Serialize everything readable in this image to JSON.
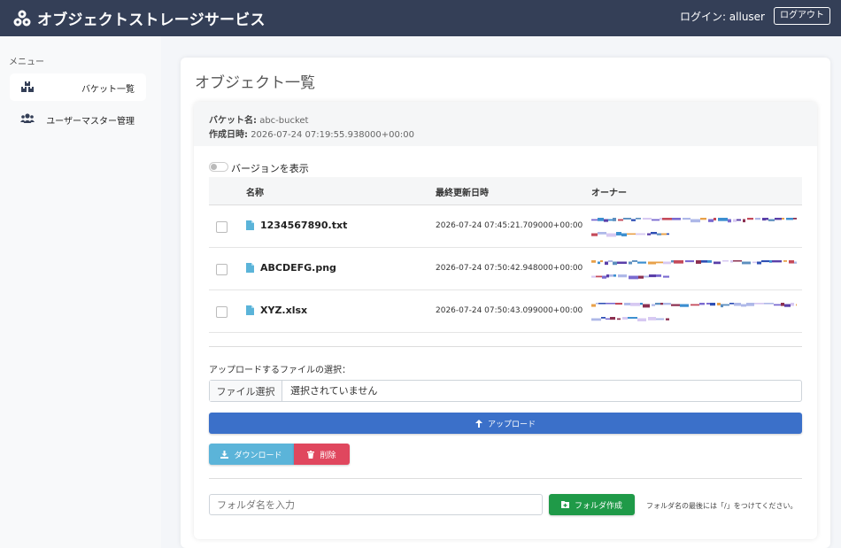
{
  "header": {
    "app_title": "オブジェクトストレージサービス",
    "login_text": "ログイン: alluser",
    "logout_label": "ログアウト",
    "background": "#343f57"
  },
  "sidebar": {
    "menu_label": "メニュー",
    "items": [
      {
        "label": "バケット一覧",
        "icon": "boxes-icon"
      },
      {
        "label": "ユーザーマスター管理",
        "icon": "users-icon"
      }
    ]
  },
  "main": {
    "page_title": "オブジェクト一覧",
    "bucket": {
      "name_label": "バケット名:",
      "name_value": "abc-bucket",
      "created_label": "作成日時:",
      "created_value": "2026-07-24 07:19:55.938000+00:00"
    },
    "version_toggle": {
      "label": "バージョンを表示",
      "checked": false
    },
    "table": {
      "columns": [
        "名称",
        "最終更新日時",
        "オーナー"
      ],
      "rows": [
        {
          "name": "1234567890.txt",
          "modified": "2026-07-24 07:45:21.709000+00:00",
          "owner_redacted": true
        },
        {
          "name": "ABCDEFG.png",
          "modified": "2026-07-24 07:50:42.948000+00:00",
          "owner_redacted": true
        },
        {
          "name": "XYZ.xlsx",
          "modified": "2026-07-24 07:50:43.099000+00:00",
          "owner_redacted": true
        }
      ]
    },
    "upload": {
      "label": "アップロードするファイルの選択：",
      "file_button": "ファイル選択",
      "file_status": "選択されていません",
      "upload_button": "アップロード",
      "upload_color": "#3b70c9"
    },
    "actions": {
      "download_label": "ダウンロード",
      "download_color": "#5bb4d9",
      "delete_label": "削除",
      "delete_color": "#e0475e"
    },
    "folder": {
      "placeholder": "フォルダ名を入力",
      "create_label": "フォルダ作成",
      "create_color": "#1f9a48",
      "hint": "フォルダ名の最後には「/」をつけてください。"
    }
  }
}
